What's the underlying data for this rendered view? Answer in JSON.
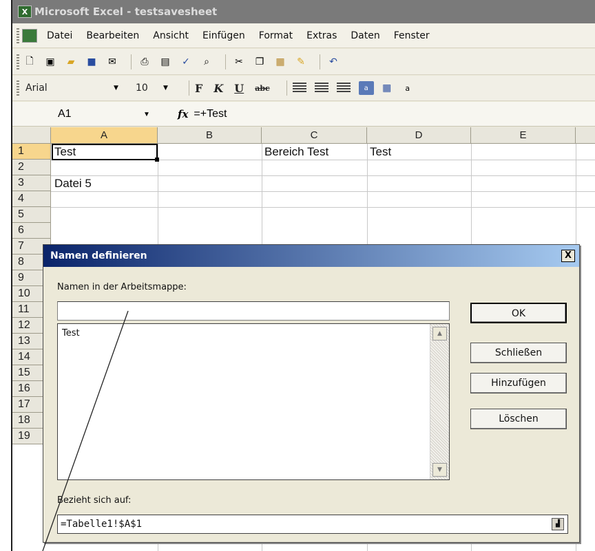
{
  "window": {
    "title": "Microsoft Excel - testsavesheet"
  },
  "menu": [
    "Datei",
    "Bearbeiten",
    "Ansicht",
    "Einfügen",
    "Format",
    "Extras",
    "Daten",
    "Fenster"
  ],
  "format_toolbar": {
    "font": "Arial",
    "size": "10"
  },
  "formula_bar": {
    "name_box": "A1",
    "fx": "fx",
    "formula": "=+Test"
  },
  "grid": {
    "columns": [
      "A",
      "B",
      "C",
      "D",
      "E"
    ],
    "rows": [
      "1",
      "2",
      "3",
      "4",
      "5",
      "6",
      "7",
      "8",
      "9",
      "10",
      "11",
      "12",
      "13",
      "14",
      "15",
      "16",
      "17",
      "18",
      "19"
    ],
    "cells": {
      "A1": "Test",
      "C1": "Bereich Test",
      "D1": "Test",
      "A3": "Datei 5"
    }
  },
  "dialog": {
    "title": "Namen definieren",
    "close": "X",
    "names_label": "Namen in der Arbeitsmappe:",
    "name_input": "",
    "list": [
      "Test"
    ],
    "refers_label": "Bezieht sich auf:",
    "refers_value": "=Tabelle1!$A$1",
    "buttons": {
      "ok": "OK",
      "close": "Schließen",
      "add": "Hinzufügen",
      "delete": "Löschen"
    }
  }
}
